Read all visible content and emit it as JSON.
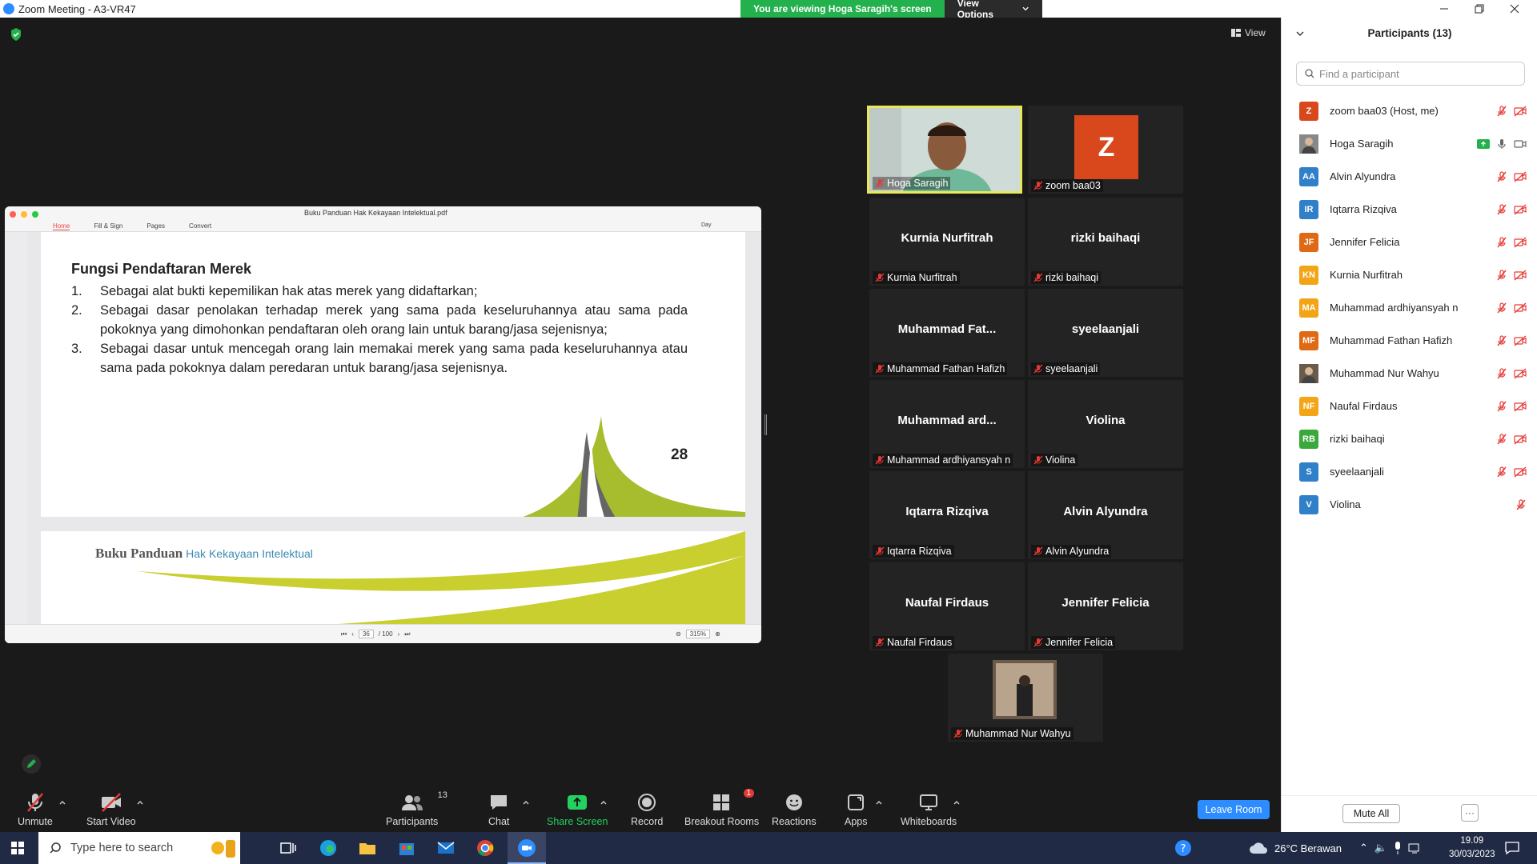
{
  "window": {
    "title": "Zoom Meeting - A3-VR47"
  },
  "banner": {
    "viewing": "You are viewing Hoga Saragih's screen",
    "view_options": "View Options"
  },
  "meeting": {
    "view_label": "View"
  },
  "shared_doc": {
    "filename": "Buku Panduan Hak Kekayaan Intelektual.pdf",
    "tabs": [
      "Home",
      "Fill & Sign",
      "Pages",
      "Convert"
    ],
    "day_mode": "Day",
    "heading": "Fungsi Pendaftaran Merek",
    "items": [
      {
        "num": "1.",
        "text": "Sebagai alat bukti kepemilikan hak atas merek yang didaftarkan;"
      },
      {
        "num": "2.",
        "text": "Sebagai dasar penolakan terhadap merek yang sama pada keseluruhannya atau sama pada pokoknya yang dimohonkan pendaftaran oleh orang lain untuk barang/jasa sejenisnya;"
      },
      {
        "num": "3.",
        "text": "Sebagai dasar untuk mencegah orang lain memakai merek yang sama pada keseluruhannya atau sama pada pokoknya dalam peredaran untuk barang/jasa sejenisnya."
      }
    ],
    "page_number_printed": "28",
    "page2_title": "Buku Panduan",
    "page2_subtitle": "Hak Kekayaan Intelektual",
    "current_page": "36",
    "total_pages": "/ 100",
    "zoom": "315%"
  },
  "tiles": [
    {
      "big": "",
      "name": "Hoga Saragih",
      "kind": "video-hoga"
    },
    {
      "big": "Z",
      "name": "zoom baa03",
      "kind": "avatar-z"
    },
    {
      "big": "Kurnia Nurfitrah",
      "name": "Kurnia Nurfitrah"
    },
    {
      "big": "rizki baihaqi",
      "name": "rizki baihaqi"
    },
    {
      "big": "Muhammad  Fat...",
      "name": "Muhammad Fathan Hafizh"
    },
    {
      "big": "syeelaanjali",
      "name": "syeelaanjali"
    },
    {
      "big": "Muhammad  ard...",
      "name": "Muhammad ardhiyansyah n"
    },
    {
      "big": "Violina",
      "name": "Violina"
    },
    {
      "big": "Iqtarra Rizqiva",
      "name": "Iqtarra Rizqiva"
    },
    {
      "big": "Alvin Alyundra",
      "name": "Alvin Alyundra"
    },
    {
      "big": "Naufal Firdaus",
      "name": "Naufal Firdaus"
    },
    {
      "big": "Jennifer Felicia",
      "name": "Jennifer Felicia"
    },
    {
      "big": "",
      "name": "Muhammad Nur Wahyu",
      "kind": "video-wahyu"
    }
  ],
  "toolbar": {
    "unmute": "Unmute",
    "start_video": "Start Video",
    "participants": "Participants",
    "participants_count": "13",
    "chat": "Chat",
    "share_screen": "Share Screen",
    "record": "Record",
    "breakout_rooms": "Breakout Rooms",
    "breakout_badge": "1",
    "reactions": "Reactions",
    "apps": "Apps",
    "whiteboards": "Whiteboards",
    "leave": "Leave Room"
  },
  "panel": {
    "title": "Participants (13)",
    "search_placeholder": "Find a participant",
    "participants": [
      {
        "initials": "Z",
        "name": "zoom baa03 (Host, me)",
        "color": "#d9481c",
        "video": false
      },
      {
        "initials": "",
        "name": "Hoga Saragih",
        "color": "#888888",
        "photo": true,
        "sharing": true,
        "mic_on": true,
        "video": true
      },
      {
        "initials": "AA",
        "name": "Alvin Alyundra",
        "color": "#2f7fc9",
        "video": false
      },
      {
        "initials": "IR",
        "name": "Iqtarra Rizqiva",
        "color": "#2f7fc9",
        "video": false
      },
      {
        "initials": "JF",
        "name": "Jennifer Felicia",
        "color": "#e06a13",
        "video": false
      },
      {
        "initials": "KN",
        "name": "Kurnia Nurfitrah",
        "color": "#f2a516",
        "video": false
      },
      {
        "initials": "MA",
        "name": "Muhammad ardhiyansyah n",
        "color": "#f2a516",
        "video": false
      },
      {
        "initials": "MF",
        "name": "Muhammad Fathan Hafizh",
        "color": "#e06a13",
        "video": false
      },
      {
        "initials": "",
        "name": "Muhammad Nur Wahyu",
        "color": "#6b5a4a",
        "photo": true,
        "video": false
      },
      {
        "initials": "NF",
        "name": "Naufal Firdaus",
        "color": "#f2a516",
        "video": false
      },
      {
        "initials": "RB",
        "name": "rizki baihaqi",
        "color": "#3aa83a",
        "video": false
      },
      {
        "initials": "S",
        "name": "syeelaanjali",
        "color": "#2f7fc9",
        "video": false
      },
      {
        "initials": "V",
        "name": "Violina",
        "color": "#2f7fc9",
        "no_video_icon": true
      }
    ],
    "mute_all": "Mute All",
    "more": "···"
  },
  "taskbar": {
    "search_placeholder": "Type here to search",
    "weather": "26°C  Berawan",
    "time": "19.09",
    "date": "30/03/2023"
  }
}
